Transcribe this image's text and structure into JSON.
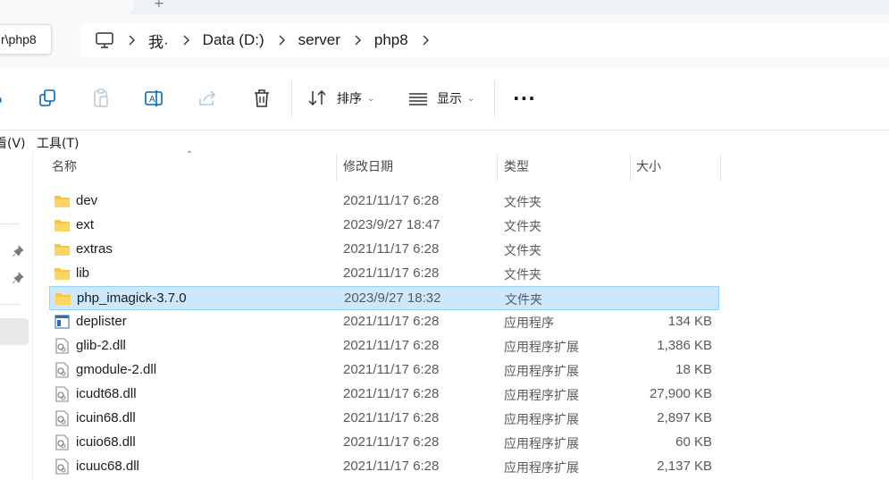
{
  "window": {
    "new_tab_symbol": "+",
    "tooltip_text": "r\\php8"
  },
  "breadcrumb": {
    "items": [
      "我·",
      "Data (D:)",
      "server",
      "php8"
    ]
  },
  "toolbar": {
    "sort_label": "排序",
    "view_label": "显示",
    "more_label": "···"
  },
  "menu": {
    "view_label": "看(V)",
    "tools_label": "工具(T)"
  },
  "columns": {
    "name": "名称",
    "date": "修改日期",
    "type": "类型",
    "size": "大小"
  },
  "files": [
    {
      "name": "dev",
      "date": "2021/11/17 6:28",
      "type": "文件夹",
      "size": "",
      "icon": "folder-icon"
    },
    {
      "name": "ext",
      "date": "2023/9/27 18:47",
      "type": "文件夹",
      "size": "",
      "icon": "folder-icon"
    },
    {
      "name": "extras",
      "date": "2021/11/17 6:28",
      "type": "文件夹",
      "size": "",
      "icon": "folder-icon"
    },
    {
      "name": "lib",
      "date": "2021/11/17 6:28",
      "type": "文件夹",
      "size": "",
      "icon": "folder-icon"
    },
    {
      "name": "php_imagick-3.7.0",
      "date": "2023/9/27 18:32",
      "type": "文件夹",
      "size": "",
      "icon": "folder-icon",
      "selected": true
    },
    {
      "name": "deplister",
      "date": "2021/11/17 6:28",
      "type": "应用程序",
      "size": "134 KB",
      "icon": "exe-icon"
    },
    {
      "name": "glib-2.dll",
      "date": "2021/11/17 6:28",
      "type": "应用程序扩展",
      "size": "1,386 KB",
      "icon": "dll-icon"
    },
    {
      "name": "gmodule-2.dll",
      "date": "2021/11/17 6:28",
      "type": "应用程序扩展",
      "size": "18 KB",
      "icon": "dll-icon"
    },
    {
      "name": "icudt68.dll",
      "date": "2021/11/17 6:28",
      "type": "应用程序扩展",
      "size": "27,900 KB",
      "icon": "dll-icon"
    },
    {
      "name": "icuin68.dll",
      "date": "2021/11/17 6:28",
      "type": "应用程序扩展",
      "size": "2,897 KB",
      "icon": "dll-icon"
    },
    {
      "name": "icuio68.dll",
      "date": "2021/11/17 6:28",
      "type": "应用程序扩展",
      "size": "60 KB",
      "icon": "dll-icon"
    },
    {
      "name": "icuuc68.dll",
      "date": "2021/11/17 6:28",
      "type": "应用程序扩展",
      "size": "2,137 KB",
      "icon": "dll-icon"
    }
  ],
  "colors": {
    "selection_bg": "#cce8ff",
    "selection_border": "#99d1ff",
    "folder": "#f8c83c"
  }
}
